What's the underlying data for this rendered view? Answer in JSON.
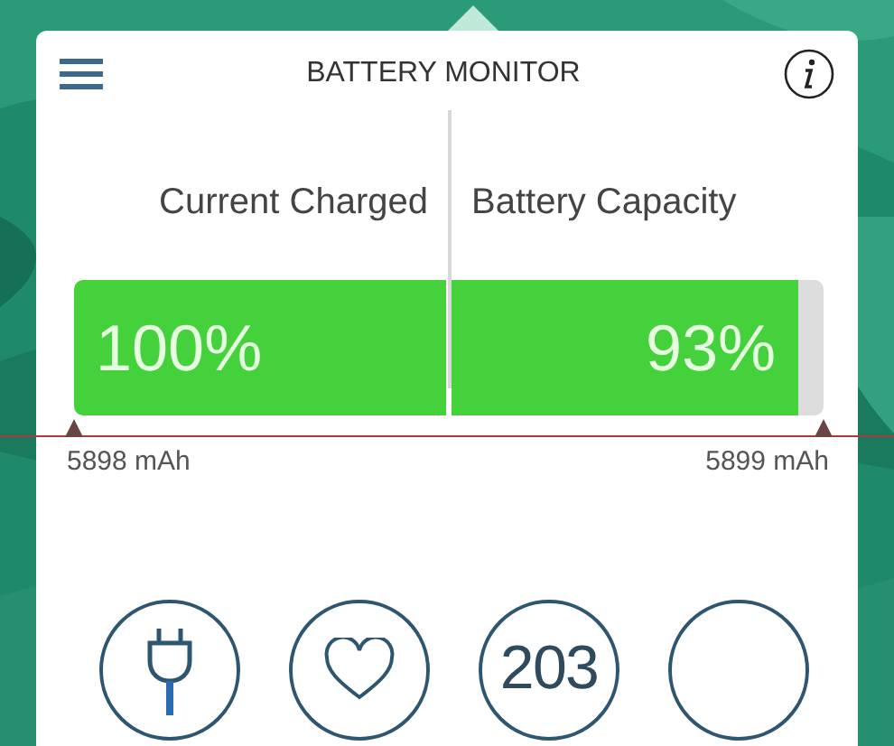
{
  "header": {
    "title": "BATTERY MONITOR"
  },
  "gauges": [
    {
      "label": "Current Charged",
      "reading": "100%",
      "level": 1,
      "capacity": "5898 mAh"
    },
    {
      "label": "Battery Capacity",
      "reading": "93%",
      "level": 0.93,
      "capacity": "5899 mAh"
    }
  ],
  "actions": [
    {
      "kind": "plug"
    },
    {
      "kind": "heart"
    },
    {
      "kind": "count",
      "text": "203"
    },
    {
      "kind": "blank"
    }
  ]
}
